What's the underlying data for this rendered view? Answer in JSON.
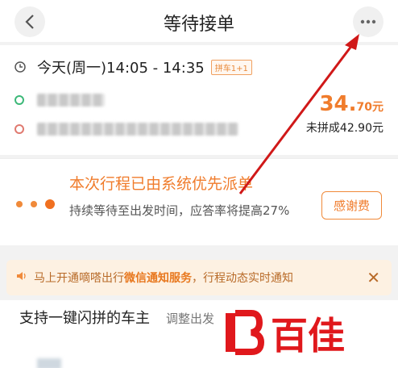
{
  "header": {
    "title": "等待接单"
  },
  "trip": {
    "time": "今天(周一)14:05 - 14:35",
    "tag": "拼车1+1",
    "price_main": "34.",
    "price_sub": "70元",
    "no_carpool": "未拼成42.90元"
  },
  "dispatch": {
    "title": "本次行程已由系统优先派单",
    "desc": "持续等待至出发时间，应答率将提高27%",
    "thanks_label": "感谢费"
  },
  "notice": {
    "prefix": "马上开通嘀嗒出行",
    "highlight": "微信通知服务",
    "suffix": "，行程动态实时通知"
  },
  "bottom": {
    "support": "支持一键闪拼的车主",
    "adjust": "调整出发"
  },
  "watermark": {
    "text": "百佳"
  },
  "colors": {
    "accent": "#f07c2c",
    "arrow": "#d01818"
  }
}
